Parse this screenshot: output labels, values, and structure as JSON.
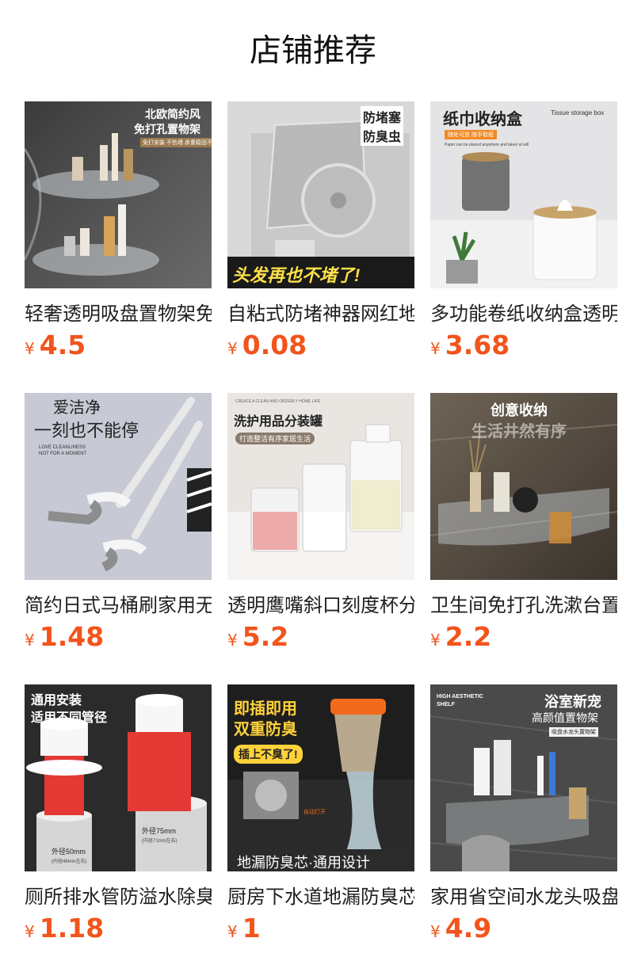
{
  "page": {
    "title": "店铺推荐"
  },
  "currency": "¥",
  "products": [
    {
      "name": "轻奢透明吸盘置物架免打孔",
      "price": "4.5",
      "image_text": [
        "北欧简约风",
        "免打孔置物架",
        "免打安装 不伤墙 承重稳固不掉落"
      ]
    },
    {
      "name": "自粘式防堵神器网红地漏贴",
      "price": "0.08",
      "image_text": [
        "防堵塞",
        "防臭虫",
        "头发再也不堵了!"
      ]
    },
    {
      "name": "多功能卷纸收纳盒透明纸巾盒",
      "price": "3.68",
      "image_text": [
        "纸巾收纳盒",
        "Tissue storage box",
        "随处可放 随手取纸",
        "Paper can be placed anywhere and taken at will"
      ]
    },
    {
      "name": "简约日式马桶刷家用无死角",
      "price": "1.48",
      "image_text": [
        "爱洁净",
        "一刻也不能停",
        "LOVE CLEANLINESS",
        "NOT FOR A MOMENT"
      ]
    },
    {
      "name": "透明鹰嘴斜口刻度杯分装罐",
      "price": "5.2",
      "image_text": [
        "CREATE A CLEAN AND ORDERLY HOME LIFE",
        "洗护用品分装罐",
        "打造整洁有序家居生活"
      ]
    },
    {
      "name": "卫生间免打孔洗漱台置物架",
      "price": "2.2",
      "image_text": [
        "创意收纳",
        "生活井然有序"
      ]
    },
    {
      "name": "厕所排水管防溢水除臭密封圈",
      "price": "1.18",
      "image_text": [
        "通用安装",
        "适用不同管径",
        "外径75mm",
        "(内径71mm左右)",
        "外径50mm",
        "(内径46mm左右)"
      ]
    },
    {
      "name": "厨房下水道地漏防臭芯通用",
      "price": "1",
      "image_text": [
        "即插即用",
        "双重防臭",
        "插上不臭了!",
        "自动打开",
        "地漏防臭芯·通用设计"
      ]
    },
    {
      "name": "家用省空间水龙头吸盘置物架",
      "price": "4.9",
      "image_text": [
        "HIGH AESTHETIC",
        "SHELF",
        "浴室新宠",
        "高颜值置物架",
        "吸盘水龙头置物架"
      ]
    }
  ],
  "colors": {
    "price": "#f2541b",
    "title": "#111111",
    "text": "#1f1f1f"
  }
}
